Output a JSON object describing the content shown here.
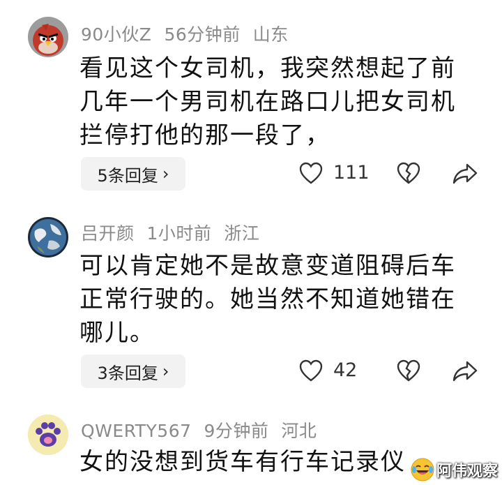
{
  "comments": [
    {
      "username": "90小伙Z",
      "time": "56分钟前",
      "location": "山东",
      "text": "看见这个女司机，我突然想起了前\n几年一个男司机在路口儿把女司机\n拦停打他的那一段了，",
      "replies_label": "5条回复",
      "likes": "111",
      "avatar": "angry-bird-avatar"
    },
    {
      "username": "吕开颜",
      "time": "1小时前",
      "location": "浙江",
      "text": "可以肯定她不是故意变道阻碍后车\n正常行驶的。她当然不知道她错在\n哪儿。",
      "replies_label": "3条回复",
      "likes": "42",
      "avatar": "earth-globe-avatar"
    },
    {
      "username": "QWERTY567",
      "time": "9分钟前",
      "location": "河北",
      "text": "女的没想到货车有行车记录仪",
      "avatar": "paw-print-avatar"
    }
  ],
  "icons": {
    "like": "heart-outline-icon",
    "dislike": "broken-heart-icon",
    "share": "share-arrow-icon",
    "chevron": "›"
  },
  "watermark": {
    "text": "阿伟观察",
    "emoji": "laughing-crying-emoji"
  },
  "colors": {
    "meta_gray": "#8a8a8a",
    "reply_bg": "#f2f2f2",
    "text": "#111111"
  }
}
